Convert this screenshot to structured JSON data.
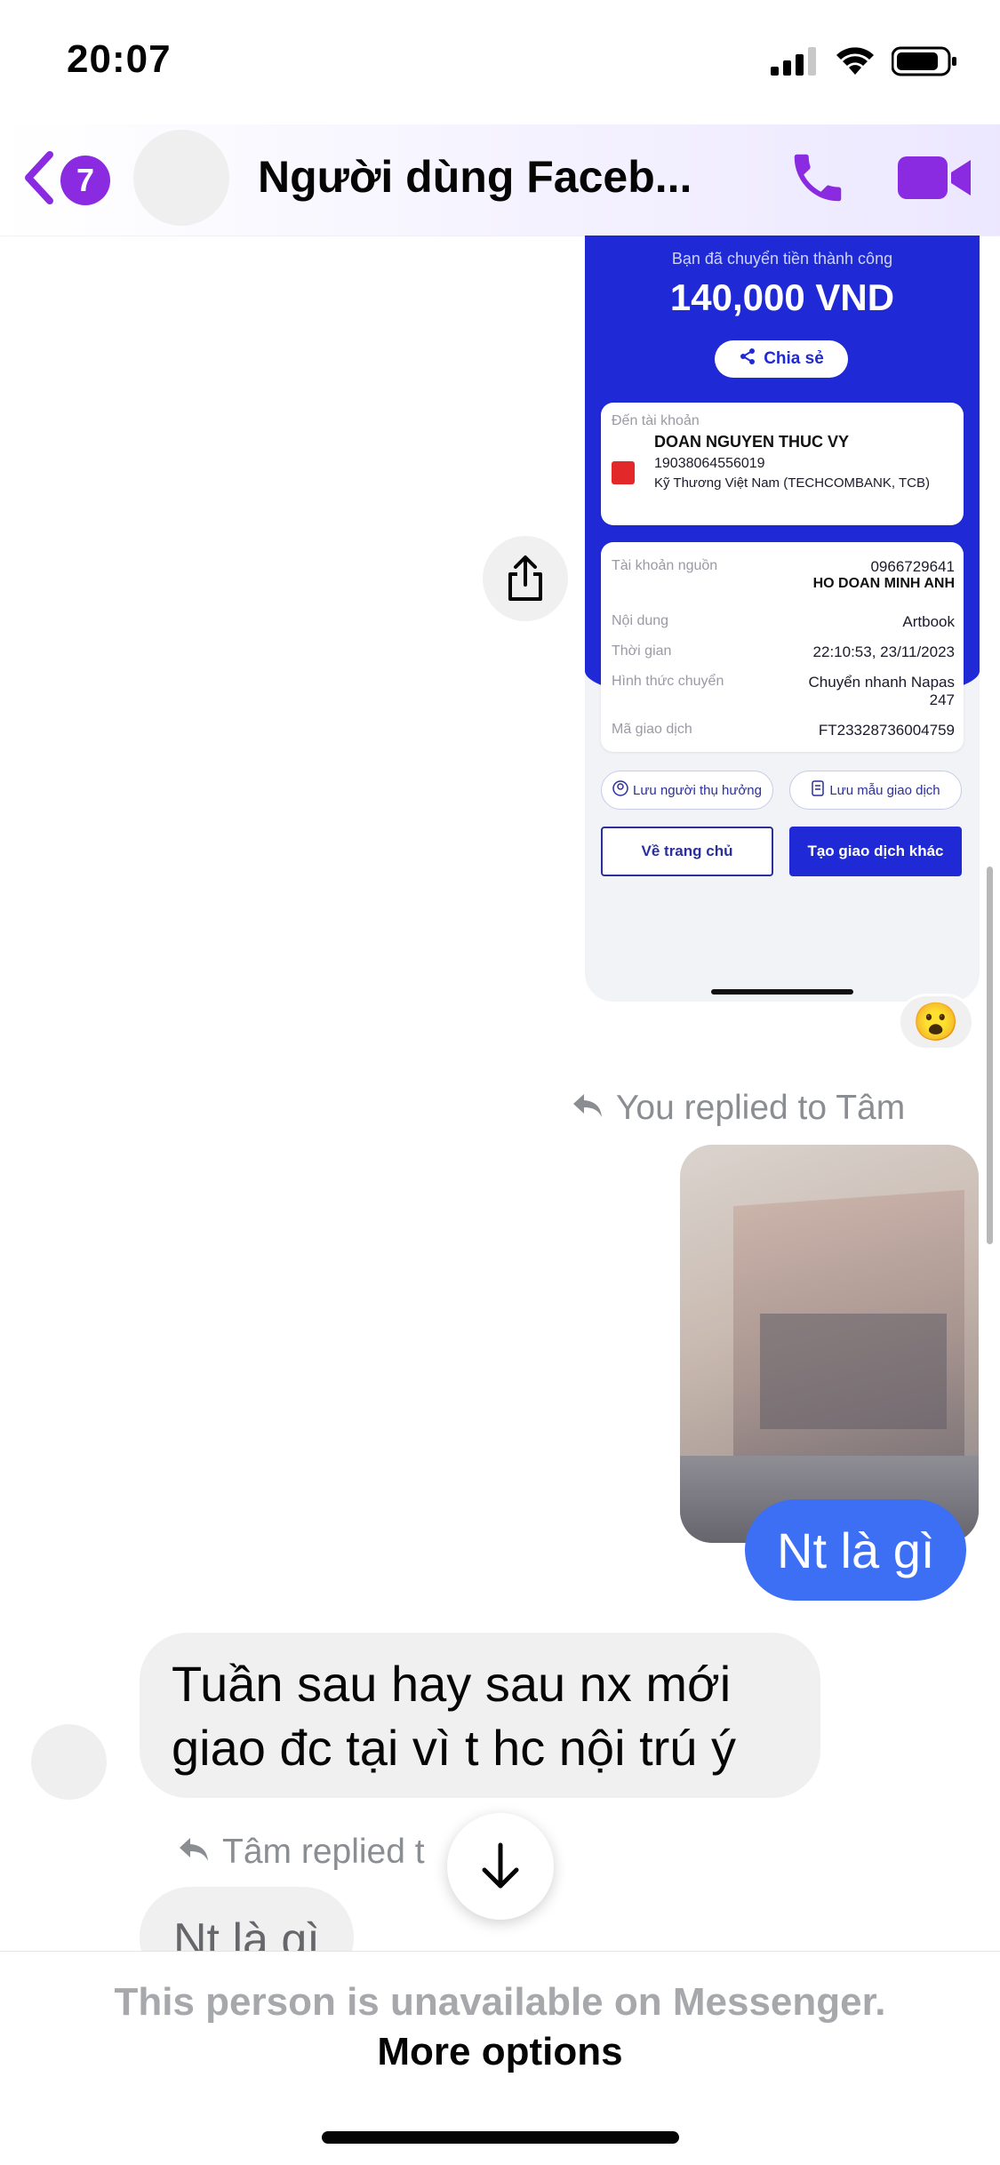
{
  "status_bar": {
    "time": "20:07"
  },
  "header": {
    "back_badge": "7",
    "title": "Người dùng Faceb...",
    "accent_color": "#8a2be2"
  },
  "receipt": {
    "success_text": "Bạn đã chuyển tiền thành công",
    "amount": "140,000 VND",
    "share_label": "Chia sẻ",
    "to_account_label": "Đến tài khoản",
    "recipient_name": "DOAN NGUYEN THUC VY",
    "recipient_account": "19038064556019",
    "recipient_bank": "Kỹ Thương Việt Nam (TECHCOMBANK, TCB)",
    "details": [
      {
        "label": "Tài khoản nguồn",
        "value": "0966729641",
        "value2": "HO DOAN MINH ANH"
      },
      {
        "label": "Nội dung",
        "value": "Artbook"
      },
      {
        "label": "Thời gian",
        "value": "22:10:53, 23/11/2023"
      },
      {
        "label": "Hình thức chuyển",
        "value": "Chuyển nhanh Napas 247"
      },
      {
        "label": "Mã giao dịch",
        "value": "FT23328736004759"
      }
    ],
    "save_beneficiary": "Lưu người thụ hưởng",
    "save_template": "Lưu mẫu giao dịch",
    "home_button": "Về trang chủ",
    "new_transaction_button": "Tạo giao dịch khác",
    "brand_color": "#1f2ad6"
  },
  "reaction": "😮",
  "messages": {
    "reply_context_out": "You replied to Tâm",
    "outgoing_text": "Nt là gì",
    "incoming_text": "Tuần sau hay sau nx mới giao đc tại vì t hc nội trú ý",
    "reply_context_in": "Tâm replied t",
    "incoming_partial": "Nt là gì",
    "outgoing_color": "#3d6ff5"
  },
  "footer": {
    "unavailable_text": "This person is unavailable on Messenger.",
    "more_options": "More options"
  }
}
